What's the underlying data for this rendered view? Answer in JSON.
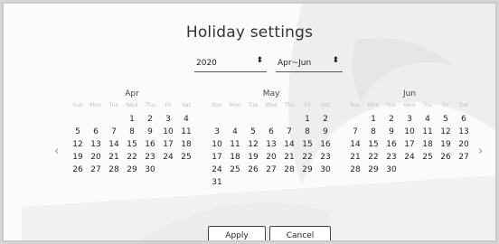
{
  "dialog": {
    "title": "Holiday settings"
  },
  "filters": {
    "year": "2020",
    "period": "Apr~Jun",
    "select_arrow_icon": "updown-arrow-icon"
  },
  "nav": {
    "prev": "‹",
    "next": "›"
  },
  "calendars": [
    {
      "name": "Apr",
      "weekdays": [
        "Sun",
        "Mon",
        "Tue",
        "Wed",
        "Thu",
        "Fri",
        "Sat"
      ],
      "leading_blanks": 3,
      "days": [
        "1",
        "2",
        "3",
        "4",
        "5",
        "6",
        "7",
        "8",
        "9",
        "10",
        "11",
        "12",
        "13",
        "14",
        "15",
        "16",
        "17",
        "18",
        "19",
        "20",
        "21",
        "22",
        "23",
        "24",
        "25",
        "26",
        "27",
        "28",
        "29",
        "30"
      ]
    },
    {
      "name": "May",
      "weekdays": [
        "Sun",
        "Mon",
        "Tue",
        "Wed",
        "Thu",
        "Fri",
        "Sat"
      ],
      "leading_blanks": 5,
      "days": [
        "1",
        "2",
        "3",
        "4",
        "5",
        "6",
        "7",
        "8",
        "9",
        "10",
        "11",
        "12",
        "13",
        "14",
        "15",
        "16",
        "17",
        "18",
        "19",
        "20",
        "21",
        "22",
        "23",
        "24",
        "25",
        "26",
        "27",
        "28",
        "29",
        "30",
        "31"
      ]
    },
    {
      "name": "Jun",
      "weekdays": [
        "Sun",
        "Mon",
        "Tue",
        "Wed",
        "Thu",
        "Fri",
        "Sat"
      ],
      "leading_blanks": 1,
      "days": [
        "1",
        "2",
        "3",
        "4",
        "5",
        "6",
        "7",
        "8",
        "9",
        "10",
        "11",
        "12",
        "13",
        "14",
        "15",
        "16",
        "17",
        "18",
        "19",
        "20",
        "21",
        "22",
        "23",
        "24",
        "25",
        "26",
        "27",
        "28",
        "29",
        "30"
      ]
    }
  ],
  "actions": {
    "apply": "Apply",
    "cancel": "Cancel"
  }
}
